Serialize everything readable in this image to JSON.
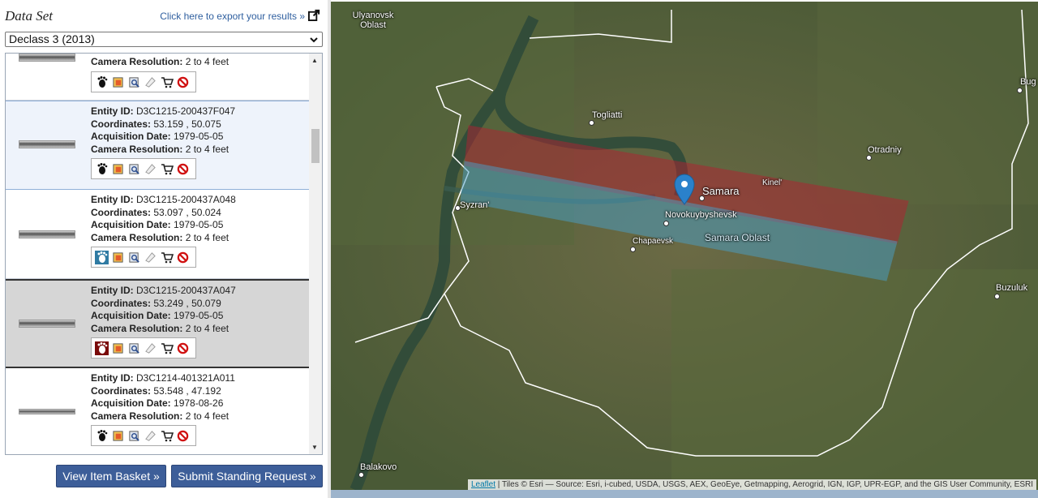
{
  "panel": {
    "title": "Data Set",
    "export_link": "Click here to export your results »",
    "dataset_selected": "Declass 3 (2013)"
  },
  "labels": {
    "entity": "Entity ID:",
    "coords": "Coordinates:",
    "acq": "Acquisition Date:",
    "res": "Camera Resolution:"
  },
  "results": [
    {
      "entity_id": "",
      "coordinates": "",
      "acquisition_date": "",
      "camera_resolution": "2 to 4 feet"
    },
    {
      "entity_id": "D3C1215-200437F047",
      "coordinates": "53.159 , 50.075",
      "acquisition_date": "1979-05-05",
      "camera_resolution": "2 to 4 feet"
    },
    {
      "entity_id": "D3C1215-200437A048",
      "coordinates": "53.097 , 50.024",
      "acquisition_date": "1979-05-05",
      "camera_resolution": "2 to 4 feet"
    },
    {
      "entity_id": "D3C1215-200437A047",
      "coordinates": "53.249 , 50.079",
      "acquisition_date": "1979-05-05",
      "camera_resolution": "2 to 4 feet"
    },
    {
      "entity_id": "D3C1214-401321A011",
      "coordinates": "53.548 , 47.192",
      "acquisition_date": "1978-08-26",
      "camera_resolution": "2 to 4 feet"
    }
  ],
  "tool_icons": [
    "footprint-icon",
    "overlay-icon",
    "metadata-icon",
    "exclude-icon",
    "cart-icon",
    "remove-icon"
  ],
  "buttons": {
    "basket": "View Item Basket »",
    "standing": "Submit Standing Request »"
  },
  "map": {
    "places": [
      "Ulyanovsk Oblast",
      "Togliatti",
      "Otradniy",
      "Samara",
      "Kinel'",
      "Syzran'",
      "Novokuybyshevsk",
      "Chapaevsk",
      "Samara Oblast",
      "Buzuluk",
      "Bug",
      "Balakovo"
    ],
    "attribution_link": "Leaflet",
    "attribution_text": "| Tiles © Esri — Source: Esri, i-cubed, USDA, USGS, AEX, GeoEye, Getmapping, Aerogrid, IGN, IGP, UPR-EGP, and the GIS User Community, ESRI",
    "footprint_red": "#b22233",
    "footprint_blue": "#4aa0c8",
    "marker_color": "#2a81cb"
  },
  "colors": {
    "button": "#3d5e99",
    "link": "#2f5f9f"
  }
}
